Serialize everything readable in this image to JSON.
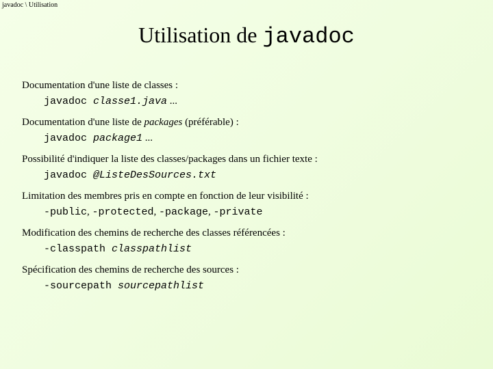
{
  "breadcrumb": "javadoc \\ Utilisation",
  "title_prefix": "Utilisation de ",
  "title_mono": "javadoc",
  "sections": [
    {
      "desc_pre": "Documentation d'une liste de classes :",
      "desc_em": "",
      "desc_post": "",
      "cmd_mono": "javadoc ",
      "cmd_mono_italic": "classe1.java",
      "cmd_tail": " ..."
    },
    {
      "desc_pre": "Documentation d'une liste de ",
      "desc_em": "packages",
      "desc_post": " (préférable) :",
      "cmd_mono": "javadoc ",
      "cmd_mono_italic": "package1",
      "cmd_tail": " ..."
    },
    {
      "desc_pre": "Possibilité d'indiquer la liste des classes/packages dans un fichier texte :",
      "desc_em": "",
      "desc_post": "",
      "cmd_mono": "javadoc ",
      "cmd_mono_italic": "@ListeDesSources.txt",
      "cmd_tail": ""
    },
    {
      "desc_pre": "Limitation des membres pris en compte en fonction de leur visibilité :",
      "desc_em": "",
      "desc_post": "",
      "cmd_mono": "-public",
      "cmd_sep1": ", ",
      "cmd_mono2": "-protected",
      "cmd_sep2": ", ",
      "cmd_mono3": "-package",
      "cmd_sep3": ", ",
      "cmd_mono4": "-private"
    },
    {
      "desc_pre": "Modification des chemins de recherche des classes référencées :",
      "desc_em": "",
      "desc_post": "",
      "cmd_mono": "-classpath ",
      "cmd_mono_italic": "classpathlist",
      "cmd_tail": ""
    },
    {
      "desc_pre": "Spécification des chemins de recherche des sources :",
      "desc_em": "",
      "desc_post": "",
      "cmd_mono": "-sourcepath ",
      "cmd_mono_italic": "sourcepathlist",
      "cmd_tail": ""
    }
  ]
}
